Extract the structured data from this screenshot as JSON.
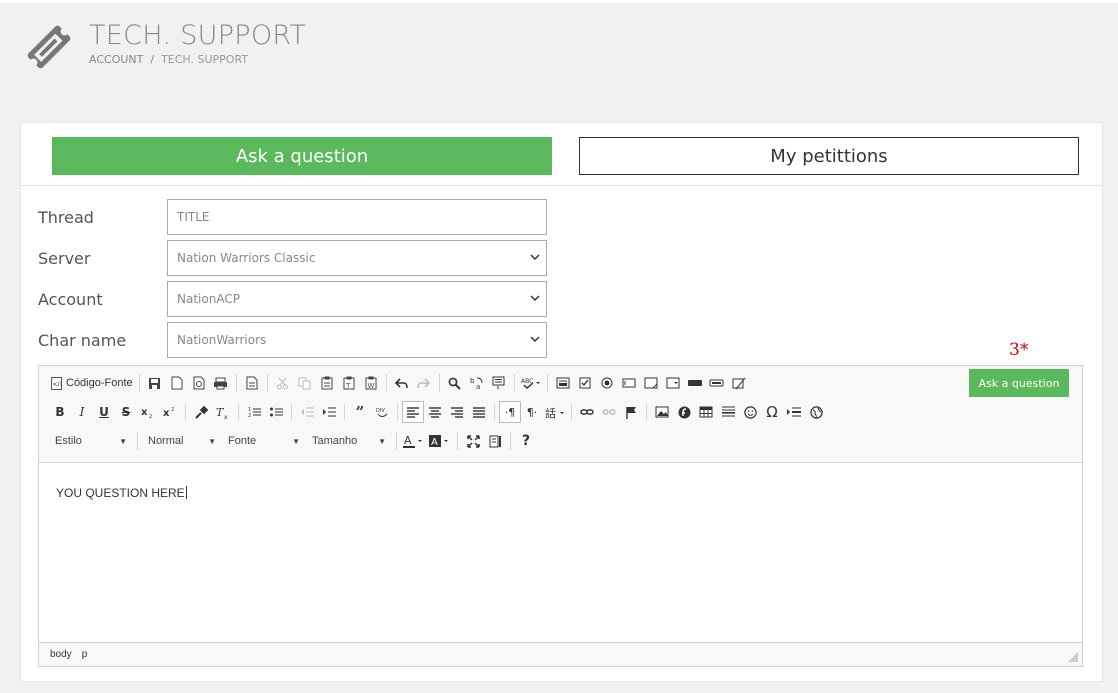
{
  "header": {
    "title": "TECH. SUPPORT",
    "breadcrumb": [
      "ACCOUNT",
      "TECH. SUPPORT"
    ],
    "breadcrumb_sep": "/",
    "logo_icon": "ticket-icon"
  },
  "tabs": {
    "ask": "Ask a question",
    "petitions": "My petittions",
    "active_color": "#5cb85c"
  },
  "form": {
    "thread_label": "Thread",
    "thread_placeholder": "TITLE",
    "server_label": "Server",
    "server_value": "Nation Warriors Classic",
    "account_label": "Account",
    "account_value": "NationACP",
    "char_label": "Char name",
    "char_value": "NationWarriors"
  },
  "marker": "3*",
  "editor": {
    "source_label": "Código-Fonte",
    "style_combo": "Estilo",
    "format_combo": "Normal",
    "font_combo": "Fonte",
    "size_combo": "Tamanho",
    "content": "YOU QUESTION HERE",
    "path": [
      "body",
      "p"
    ]
  },
  "submit_label": "Ask a question"
}
